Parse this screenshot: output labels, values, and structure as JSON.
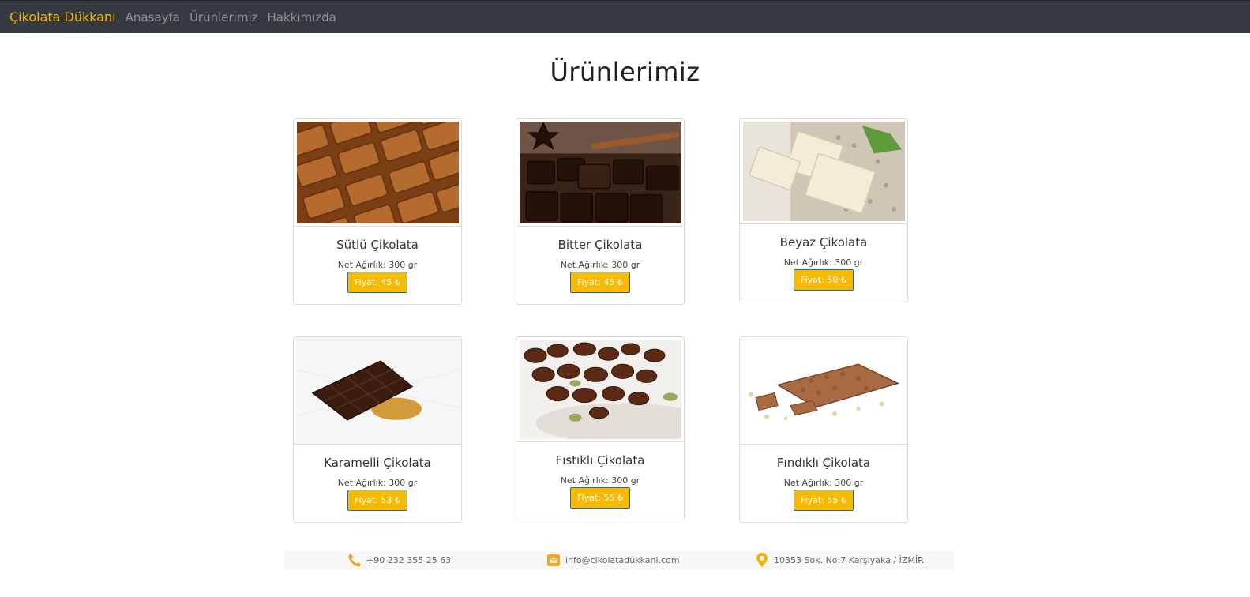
{
  "navbar": {
    "brand": "Çikolata Dükkanı",
    "links": [
      "Anasayfa",
      "Ürünlerimiz",
      "Hakkımızda"
    ]
  },
  "page": {
    "title": "Ürünlerimiz"
  },
  "products": [
    {
      "name": "Sütlü Çikolata",
      "weight": "Net Ağırlık: 300 gr",
      "price": "Fiyat: 45 ₺"
    },
    {
      "name": "Bitter Çikolata",
      "weight": "Net Ağırlık: 300 gr",
      "price": "Fiyat: 45 ₺"
    },
    {
      "name": "Beyaz Çikolata",
      "weight": "Net Ağırlık: 300 gr",
      "price": "Fiyat: 50 ₺"
    },
    {
      "name": "Karamelli Çikolata",
      "weight": "Net Ağırlık: 300 gr",
      "price": "Fiyat: 53 ₺"
    },
    {
      "name": "Fıstıklı Çikolata",
      "weight": "Net Ağırlık: 300 gr",
      "price": "Fiyat: 55 ₺"
    },
    {
      "name": "Fındıklı Çikolata",
      "weight": "Net Ağırlık: 300 gr",
      "price": "Fiyat: 55 ₺"
    }
  ],
  "footer": {
    "phone": "+90 232 355 25 63",
    "email": "info@cikolatadukkani.com",
    "address": "10353 Sok. No:7 Karşıyaka / İZMİR"
  },
  "colors": {
    "accent": "#f9b900",
    "navbar": "#343a40",
    "brand": "#f5b301"
  },
  "icons": {
    "phone": "phone-icon",
    "email": "email-icon",
    "address": "location-pin-icon"
  }
}
